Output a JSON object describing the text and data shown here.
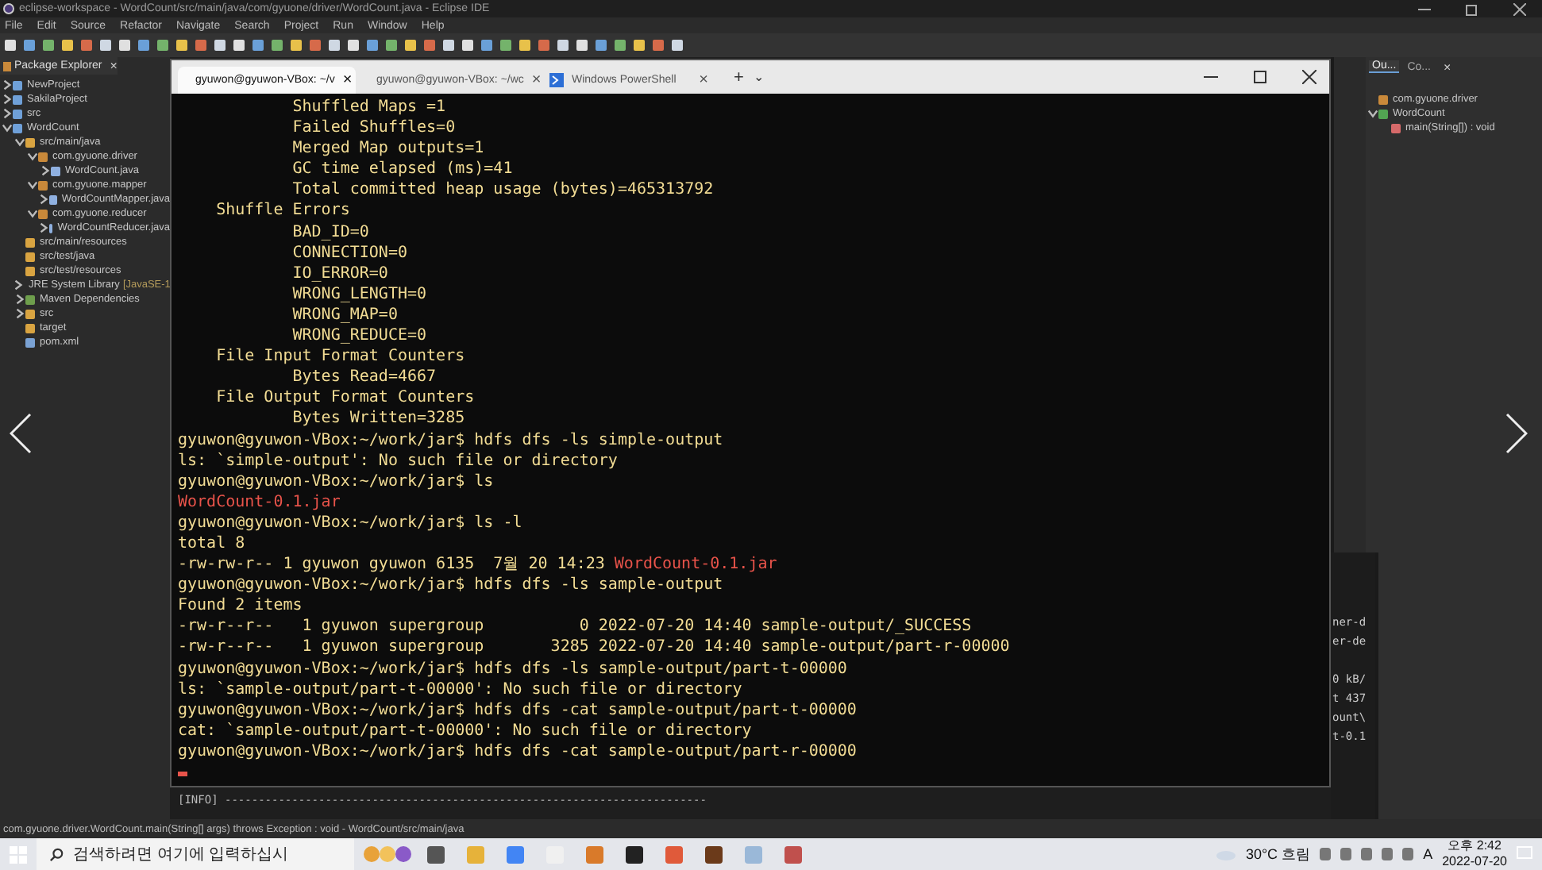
{
  "window": {
    "title": "eclipse-workspace - WordCount/src/main/java/com/gyuone/driver/WordCount.java - Eclipse IDE"
  },
  "menu": [
    "File",
    "Edit",
    "Source",
    "Refactor",
    "Navigate",
    "Search",
    "Project",
    "Run",
    "Window",
    "Help"
  ],
  "package_explorer": {
    "title": "Package Explorer",
    "close": "×",
    "tree": [
      {
        "label": "NewProject",
        "kind": "project",
        "expanded": false
      },
      {
        "label": "SakilaProject",
        "kind": "project",
        "expanded": false
      },
      {
        "label": "src",
        "kind": "project",
        "expanded": false
      },
      {
        "label": "WordCount",
        "kind": "project",
        "expanded": true,
        "children": [
          {
            "label": "src/main/java",
            "kind": "folder",
            "expanded": true,
            "children": [
              {
                "label": "com.gyuone.driver",
                "kind": "package",
                "expanded": true,
                "children": [
                  {
                    "label": "WordCount.java",
                    "kind": "file",
                    "expanded": false
                  }
                ]
              },
              {
                "label": "com.gyuone.mapper",
                "kind": "package",
                "expanded": true,
                "children": [
                  {
                    "label": "WordCountMapper.java",
                    "kind": "file",
                    "expanded": false
                  }
                ]
              },
              {
                "label": "com.gyuone.reducer",
                "kind": "package",
                "expanded": true,
                "children": [
                  {
                    "label": "WordCountReducer.java",
                    "kind": "file",
                    "expanded": false
                  }
                ]
              }
            ]
          },
          {
            "label": "src/main/resources",
            "kind": "folder"
          },
          {
            "label": "src/test/java",
            "kind": "folder"
          },
          {
            "label": "src/test/resources",
            "kind": "folder"
          },
          {
            "label": "JRE System Library",
            "decoration": "[JavaSE-1",
            "kind": "library",
            "expanded": false
          },
          {
            "label": "Maven Dependencies",
            "kind": "library",
            "expanded": false
          },
          {
            "label": "src",
            "kind": "folder",
            "expanded": false
          },
          {
            "label": "target",
            "kind": "folder"
          },
          {
            "label": "pom.xml",
            "kind": "xml"
          }
        ]
      }
    ]
  },
  "outline": {
    "tabs": [
      {
        "label": "Ou...",
        "selected": true
      },
      {
        "label": "Co...",
        "selected": false
      }
    ],
    "close": "×",
    "tree": [
      {
        "label": "com.gyuone.driver",
        "kind": "package"
      },
      {
        "label": "WordCount",
        "kind": "class",
        "expanded": true,
        "children": [
          {
            "label": "main(String[]) : void",
            "kind": "method"
          }
        ]
      }
    ]
  },
  "terminal": {
    "tabs": [
      {
        "label": "gyuwon@gyuwon-VBox: ~/v",
        "selected": true
      },
      {
        "label": "gyuwon@gyuwon-VBox: ~/wc",
        "selected": false
      },
      {
        "label": "Windows PowerShell",
        "selected": false
      }
    ],
    "tab_close": "×",
    "new_tab": "+",
    "dropdown": "⌄",
    "lines": [
      [
        {
          "text": "            Shuffled Maps =1",
          "kind": "plain"
        }
      ],
      [
        {
          "text": "            Failed Shuffles=0",
          "kind": "plain"
        }
      ],
      [
        {
          "text": "            Merged Map outputs=1",
          "kind": "plain"
        }
      ],
      [
        {
          "text": "            GC time elapsed (ms)=41",
          "kind": "plain"
        }
      ],
      [
        {
          "text": "            Total committed heap usage (bytes)=465313792",
          "kind": "plain"
        }
      ],
      [
        {
          "text": "    Shuffle Errors",
          "kind": "plain"
        }
      ],
      [
        {
          "text": "            BAD_ID=0",
          "kind": "plain"
        }
      ],
      [
        {
          "text": "            CONNECTION=0",
          "kind": "plain"
        }
      ],
      [
        {
          "text": "            IO_ERROR=0",
          "kind": "plain"
        }
      ],
      [
        {
          "text": "            WRONG_LENGTH=0",
          "kind": "plain"
        }
      ],
      [
        {
          "text": "            WRONG_MAP=0",
          "kind": "plain"
        }
      ],
      [
        {
          "text": "            WRONG_REDUCE=0",
          "kind": "plain"
        }
      ],
      [
        {
          "text": "    File Input Format Counters",
          "kind": "plain"
        }
      ],
      [
        {
          "text": "            Bytes Read=4667",
          "kind": "plain"
        }
      ],
      [
        {
          "text": "    File Output Format Counters",
          "kind": "plain"
        }
      ],
      [
        {
          "text": "            Bytes Written=3285",
          "kind": "plain"
        }
      ],
      [
        {
          "text": "gyuwon@gyuwon-VBox:~/work/jar$ hdfs dfs -ls simple-output",
          "kind": "plain"
        }
      ],
      [
        {
          "text": "ls: `simple-output': No such file or directory",
          "kind": "plain"
        }
      ],
      [
        {
          "text": "gyuwon@gyuwon-VBox:~/work/jar$ ls",
          "kind": "plain"
        }
      ],
      [
        {
          "text": "WordCount-0.1.jar",
          "kind": "file"
        }
      ],
      [
        {
          "text": "gyuwon@gyuwon-VBox:~/work/jar$ ls -l",
          "kind": "plain"
        }
      ],
      [
        {
          "text": "total 8",
          "kind": "plain"
        }
      ],
      [
        {
          "text": "-rw-rw-r-- 1 gyuwon gyuwon 6135  7월 20 14:23 ",
          "kind": "plain"
        },
        {
          "text": "WordCount-0.1.jar",
          "kind": "file"
        }
      ],
      [
        {
          "text": "gyuwon@gyuwon-VBox:~/work/jar$ hdfs dfs -ls sample-output",
          "kind": "plain"
        }
      ],
      [
        {
          "text": "Found 2 items",
          "kind": "plain"
        }
      ],
      [
        {
          "text": "-rw-r--r--   1 gyuwon supergroup          0 2022-07-20 14:40 sample-output/_SUCCESS",
          "kind": "plain"
        }
      ],
      [
        {
          "text": "-rw-r--r--   1 gyuwon supergroup       3285 2022-07-20 14:40 sample-output/part-r-00000",
          "kind": "plain"
        }
      ],
      [
        {
          "text": "gyuwon@gyuwon-VBox:~/work/jar$ hdfs dfs -ls sample-output/part-t-00000",
          "kind": "plain"
        }
      ],
      [
        {
          "text": "ls: `sample-output/part-t-00000': No such file or directory",
          "kind": "plain"
        }
      ],
      [
        {
          "text": "gyuwon@gyuwon-VBox:~/work/jar$ hdfs dfs -cat sample-output/part-t-00000",
          "kind": "plain"
        }
      ],
      [
        {
          "text": "cat: `sample-output/part-t-00000': No such file or directory",
          "kind": "plain"
        }
      ],
      [
        {
          "text": "gyuwon@gyuwon-VBox:~/work/jar$ hdfs dfs -cat sample-output/part-r-00000",
          "kind": "plain"
        }
      ]
    ]
  },
  "console": {
    "fragments": [
      "ner-d",
      "er-de",
      "0 kB/",
      "t 437",
      "ount\\",
      "t-0.1"
    ],
    "info_line": "[INFO] ------------------------------------------------------------------------"
  },
  "status_bar": "com.gyuone.driver.WordCount.main(String[] args) throws Exception : void - WordCount/src/main/java",
  "taskbar": {
    "search_placeholder": "검색하려면 여기에 입력하십시",
    "weather": "30°C 흐림",
    "ime": "A",
    "time": "오후 2:42",
    "date": "2022-07-20"
  }
}
